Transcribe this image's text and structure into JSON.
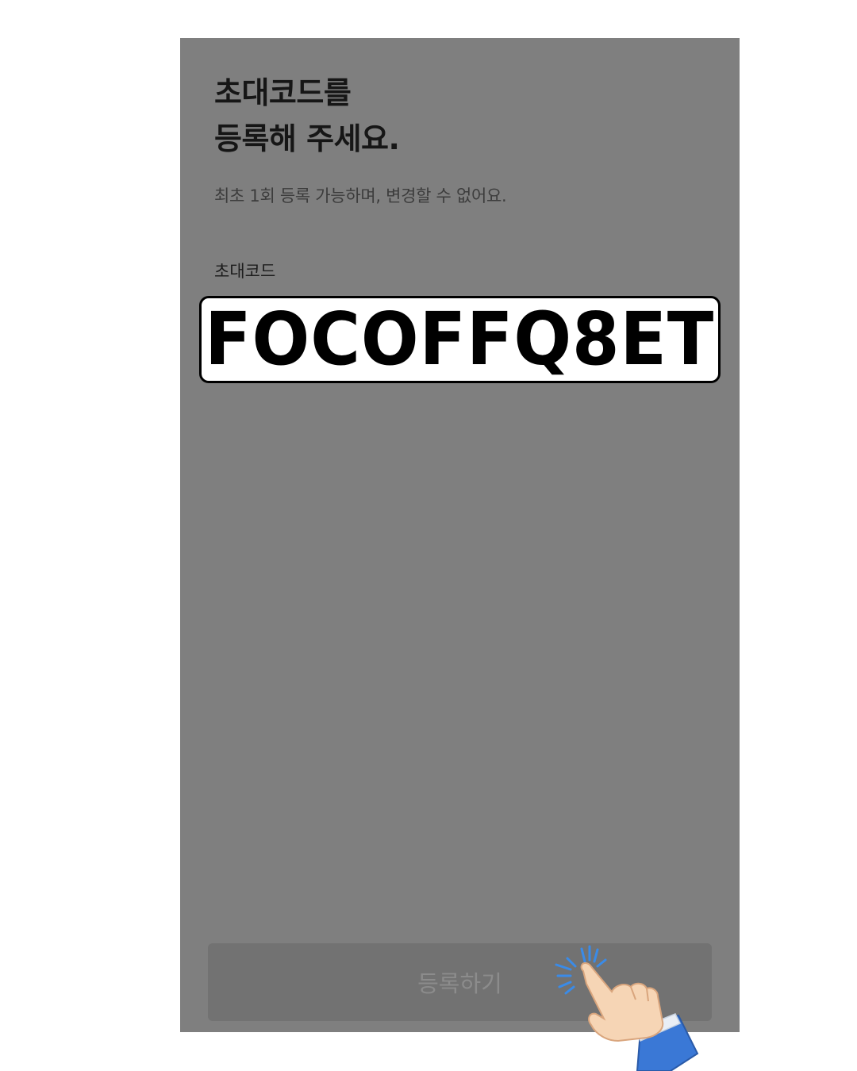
{
  "header": {
    "title_line1": "초대코드를",
    "title_line2": "등록해 주세요.",
    "subtitle": "최초 1회 등록 가능하며, 변경할 수 없어요."
  },
  "form": {
    "field_label": "초대코드",
    "code_value": "FOCOFFQ8ET"
  },
  "footer": {
    "register_label": "등록하기"
  },
  "icons": {
    "hand": "pointing-hand-tap-icon"
  },
  "colors": {
    "overlay": "#7f7f7f",
    "tap_sparkle": "#3a8be8",
    "sleeve": "#3a78d6"
  }
}
